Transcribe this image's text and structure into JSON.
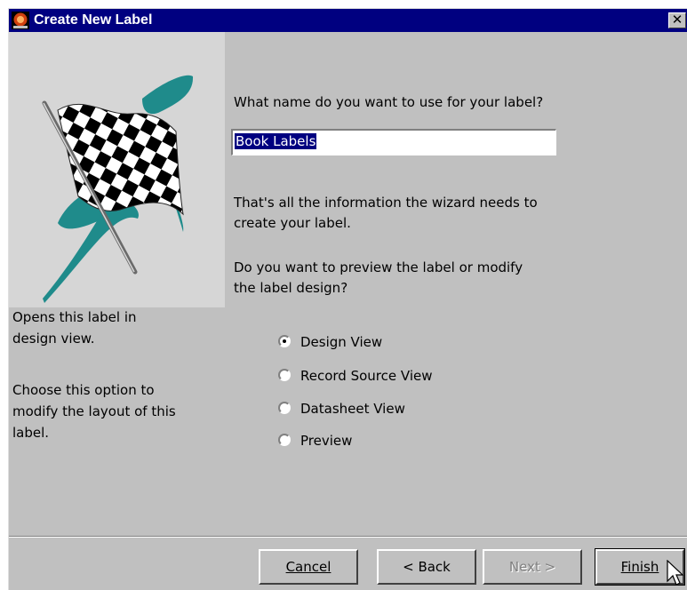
{
  "window": {
    "title": "Create New Label",
    "close_glyph": "✕"
  },
  "wizard": {
    "name_prompt": "What name do you want to use for your label?",
    "name_value": "Book Labels",
    "info_line1": "That's all the information the wizard needs to",
    "info_line2": "create your label.",
    "question_line1": "Do you want to preview the label or modify",
    "question_line2": "the label design?"
  },
  "help": {
    "line1": "Opens this label in",
    "line2": "design view.",
    "line3": "Choose this option to",
    "line4": "modify the layout of this",
    "line5": "label."
  },
  "options": [
    {
      "label": "Design View",
      "selected": true
    },
    {
      "label": "Record Source View",
      "selected": false
    },
    {
      "label": "Datasheet View",
      "selected": false
    },
    {
      "label": "Preview",
      "selected": false
    }
  ],
  "buttons": {
    "cancel": "Cancel",
    "back": "< Back",
    "next": "Next >",
    "finish": "Finish"
  },
  "icons": {
    "app": "app-icon",
    "art": "checkered-flag-illustration",
    "cursor": "mouse-pointer-icon"
  },
  "colors": {
    "titlebar": "#000080",
    "face": "#c0c0c0",
    "selection": "#000080",
    "flag_splash": "#1f8b8b"
  }
}
